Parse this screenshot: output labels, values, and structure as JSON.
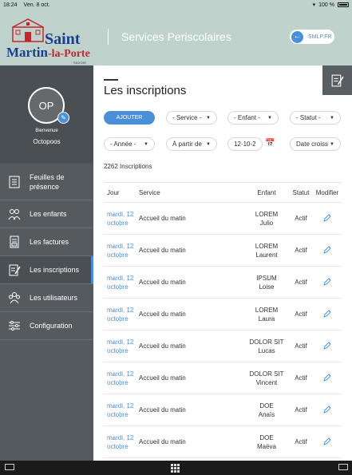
{
  "status_bar": {
    "time": "18:24",
    "date": "Ven. 8 oct.",
    "battery": "100 %"
  },
  "header": {
    "logo_line1": "Saint",
    "logo_line2a": "Martin",
    "logo_line2b": "-la-Porte",
    "logo_savoie": "SAVOIE",
    "title": "Services Periscolaires",
    "smlp_label": "SMLP.FR"
  },
  "profile": {
    "initials": "OP",
    "welcome": "Bienvenue",
    "username": "Octopoos"
  },
  "sidebar": {
    "items": [
      {
        "label_line1": "Feuilles de",
        "label_line2": "présence"
      },
      {
        "label": "Les enfants"
      },
      {
        "label": "Les factures"
      },
      {
        "label": "Les inscriptions"
      },
      {
        "label": "Les utilisateurs"
      },
      {
        "label": "Configuration"
      }
    ]
  },
  "main": {
    "title": "Les inscriptions",
    "add_label": "AJOUTER",
    "filters": {
      "service": "- Service -",
      "enfant": "- Enfant -",
      "statut": "- Statut -",
      "annee": "- Année -",
      "a_partir": "À partir de",
      "date": "12-10-2",
      "tri": "Date croissante"
    },
    "count": "2262 Inscriptions",
    "columns": {
      "jour": "Jour",
      "service": "Service",
      "enfant": "Enfant",
      "statut": "Statut",
      "modifier": "Modifier"
    },
    "rows": [
      {
        "jour1": "mardi, 12",
        "jour2": "octobre",
        "service": "Accueil du matin",
        "nom": "LOREM",
        "prenom": "Julio",
        "statut": "Actif"
      },
      {
        "jour1": "mardi, 12",
        "jour2": "octobre",
        "service": "Accueil du matin",
        "nom": "LOREM",
        "prenom": "Laurent",
        "statut": "Actif"
      },
      {
        "jour1": "mardi, 12",
        "jour2": "octobre",
        "service": "Accueil du matin",
        "nom": "IPSUM",
        "prenom": "Loise",
        "statut": "Actif"
      },
      {
        "jour1": "mardi, 12",
        "jour2": "octobre",
        "service": "Accueil du matin",
        "nom": "LOREM",
        "prenom": "Laura",
        "statut": "Actif"
      },
      {
        "jour1": "mardi, 12",
        "jour2": "octobre",
        "service": "Accueil du matin",
        "nom": "DOLOR SIT",
        "prenom": "Lucas",
        "statut": "Actif"
      },
      {
        "jour1": "mardi, 12",
        "jour2": "octobre",
        "service": "Accueil du matin",
        "nom": "DOLOR SIT",
        "prenom": "Vincent",
        "statut": "Actif"
      },
      {
        "jour1": "mardi, 12",
        "jour2": "octobre",
        "service": "Accueil du matin",
        "nom": "DOE",
        "prenom": "Anaïs",
        "statut": "Actif"
      },
      {
        "jour1": "mardi, 12",
        "jour2": "octobre",
        "service": "Accueil du matin",
        "nom": "DOE",
        "prenom": "Maëva",
        "statut": "Actif"
      }
    ]
  },
  "colors": {
    "accent": "#4a90d9",
    "header_bg": "#bfd3cc",
    "sidebar_bg": "#555a5e"
  }
}
